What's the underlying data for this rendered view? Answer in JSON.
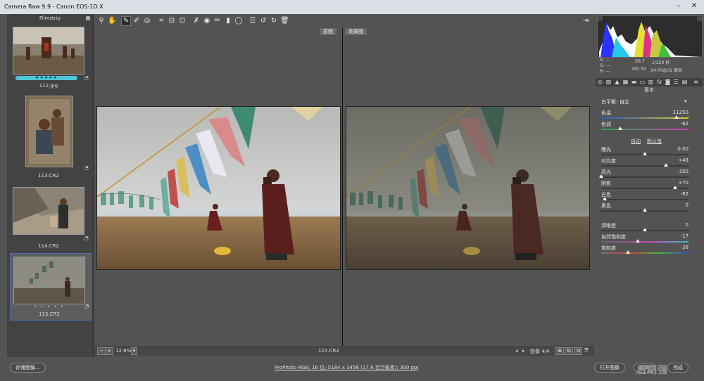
{
  "window": {
    "title": "Camera Raw 9.9 -  Canon EOS-1D X"
  },
  "filmstrip": {
    "title": "Filmstrip",
    "items": [
      {
        "name": "112.jpg",
        "rating": "★★★★★"
      },
      {
        "name": "113.CR2"
      },
      {
        "name": "114.CR2"
      },
      {
        "name": "115.CR2",
        "rating": "• • • • •"
      }
    ]
  },
  "preview": {
    "before_label": "原图",
    "after_label": "效果图",
    "zoom": "12.8%",
    "filename": "115.CR2",
    "image_counter": "图像 4/4"
  },
  "info": {
    "r": "R: ---",
    "g": "G: ---",
    "b": "B: ---",
    "aperture": "f/6.7",
    "shutter": "1/250 秒",
    "iso": "ISO 50",
    "lens": "24-70@31 毫米"
  },
  "basic": {
    "title": "基本",
    "white_balance_label": "白平衡:",
    "white_balance_value": "自定",
    "auto_label": "自动",
    "default_label": "默认值",
    "sliders": [
      {
        "label": "色温",
        "value": "11250",
        "pos": 0.86
      },
      {
        "label": "色调",
        "value": "-62",
        "pos": 0.22
      },
      {
        "label": "曝光",
        "value": "0.00",
        "pos": 0.5
      },
      {
        "label": "对比度",
        "value": "+48",
        "pos": 0.74
      },
      {
        "label": "高光",
        "value": "-100",
        "pos": 0.0
      },
      {
        "label": "阴影",
        "value": "+70",
        "pos": 0.85
      },
      {
        "label": "白色",
        "value": "-92",
        "pos": 0.04
      },
      {
        "label": "黑色",
        "value": "0",
        "pos": 0.5
      },
      {
        "label": "清晰度",
        "value": "0",
        "pos": 0.5
      },
      {
        "label": "自然饱和度",
        "value": "-17",
        "pos": 0.42
      },
      {
        "label": "饱和度",
        "value": "-38",
        "pos": 0.31
      }
    ]
  },
  "bottom": {
    "save_label": "存储图像...",
    "workflow": "ProPhoto RGB; 16 位; 5184 x 3456 (17.9 百万像素); 300 ppi",
    "open_label": "打开图像",
    "cancel_label": "取消",
    "done_label": "完成",
    "watermark": "后期强"
  },
  "colors": {
    "rating_bar": "#4fc6d8",
    "selection": "#4a6fb8"
  }
}
